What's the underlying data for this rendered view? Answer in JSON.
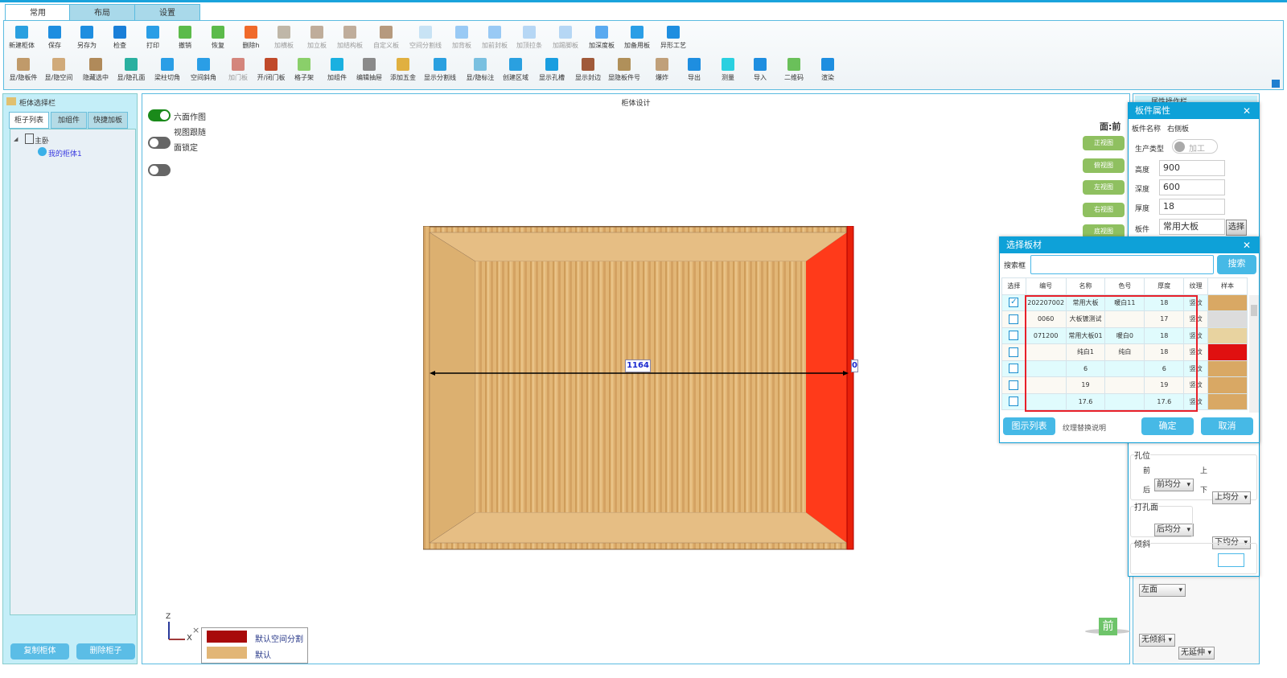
{
  "tabs": [
    "常用",
    "布局",
    "设置"
  ],
  "toolbar_row1": [
    {
      "label": "新建柜体",
      "icon": "new-cabinet-icon",
      "color": "#2aa0e0"
    },
    {
      "label": "保存",
      "icon": "save-icon",
      "color": "#1e8ee0"
    },
    {
      "label": "另存为",
      "icon": "save-as-icon",
      "color": "#1e8ee0"
    },
    {
      "label": "检查",
      "icon": "check-icon",
      "color": "#1a7fd8"
    },
    {
      "label": "打印",
      "icon": "print-icon",
      "color": "#2a9ee6"
    },
    {
      "label": "撤销",
      "icon": "undo-icon",
      "color": "#5cbb4a"
    },
    {
      "label": "恢复",
      "icon": "redo-icon",
      "color": "#5cbb4a"
    },
    {
      "label": "删除h",
      "icon": "delete-icon",
      "color": "#f06a2a"
    },
    {
      "label": "加横板",
      "icon": "horizontal-board-icon",
      "color": "#9a8a70",
      "dim": true
    },
    {
      "label": "加立板",
      "icon": "vertical-board-icon",
      "color": "#9a7a5a",
      "dim": true
    },
    {
      "label": "加结构板",
      "icon": "structure-board-icon",
      "color": "#9a7a5a",
      "dim": true
    },
    {
      "label": "自定义板",
      "icon": "custom-board-icon",
      "color": "#8a5a2a",
      "dim": true
    },
    {
      "label": "空间分割线",
      "icon": "space-divider-icon",
      "color": "#a9d4f0",
      "dim": true
    },
    {
      "label": "加背板",
      "icon": "back-board-icon",
      "color": "#5aaaf0",
      "dim": true
    },
    {
      "label": "加前封板",
      "icon": "front-seal-icon",
      "color": "#5aaaf0",
      "dim": true
    },
    {
      "label": "加顶拉条",
      "icon": "top-strip-icon",
      "color": "#8ac0f0",
      "dim": true
    },
    {
      "label": "加踢脚板",
      "icon": "kickboard-icon",
      "color": "#8ac0f0",
      "dim": true
    },
    {
      "label": "加深度板",
      "icon": "depth-board-icon",
      "color": "#5aaaf0"
    },
    {
      "label": "加备用板",
      "icon": "spare-board-icon",
      "color": "#2a9ee6"
    },
    {
      "label": "异形工艺",
      "icon": "special-shape-icon",
      "color": "#1e8ee0"
    }
  ],
  "toolbar_row2": [
    {
      "label": "显/隐板件",
      "icon": "show-hide-board-icon",
      "color": "#c09a6a"
    },
    {
      "label": "显/隐空间",
      "icon": "show-hide-space-icon",
      "color": "#d0aa7a"
    },
    {
      "label": "隐藏选中",
      "icon": "hide-selected-icon",
      "color": "#b08a5a"
    },
    {
      "label": "显/隐孔面",
      "icon": "show-hide-hole-icon",
      "color": "#2ab0a0"
    },
    {
      "label": "梁柱切角",
      "icon": "beam-cut-icon",
      "color": "#2a9ee6"
    },
    {
      "label": "空间斜角",
      "icon": "space-bevel-icon",
      "color": "#2a9ee6"
    },
    {
      "label": "加门板",
      "icon": "door-icon",
      "color": "#c03a2a",
      "dim": true
    },
    {
      "label": "开/闭门板",
      "icon": "open-close-door-icon",
      "color": "#c04a2a"
    },
    {
      "label": "格子架",
      "icon": "grid-shelf-icon",
      "color": "#8acf6a"
    },
    {
      "label": "加组件",
      "icon": "add-component-icon",
      "color": "#1ab0e0"
    },
    {
      "label": "编辑抽屉",
      "icon": "edit-drawer-icon",
      "color": "#8a8a8a"
    },
    {
      "label": "添加五金",
      "icon": "hardware-icon",
      "color": "#e0b040"
    },
    {
      "label": "显示分割线",
      "icon": "show-divider-icon",
      "color": "#2aa0e0"
    },
    {
      "label": "显/隐标注",
      "icon": "show-hide-dimension-icon",
      "color": "#7ac0e0"
    },
    {
      "label": "创建区域",
      "icon": "create-area-icon",
      "color": "#2aa0e0"
    },
    {
      "label": "显示孔槽",
      "icon": "show-holes-icon",
      "color": "#1a9ee0"
    },
    {
      "label": "显示封边",
      "icon": "show-edge-icon",
      "color": "#a05a3a"
    },
    {
      "label": "显隐板件号",
      "icon": "board-number-icon",
      "color": "#b0905a"
    },
    {
      "label": "爆炸",
      "icon": "explode-icon",
      "color": "#c0a07a"
    },
    {
      "label": "导出",
      "icon": "export-icon",
      "color": "#1e8ee0"
    },
    {
      "label": "测量",
      "icon": "measure-icon",
      "color": "#2ad0e0"
    },
    {
      "label": "导入",
      "icon": "import-icon",
      "color": "#1e8ee0"
    },
    {
      "label": "二维码",
      "icon": "qrcode-icon",
      "color": "#6ac05a"
    },
    {
      "label": "渲染",
      "icon": "render-icon",
      "color": "#1e8ee0"
    }
  ],
  "left_panel": {
    "title": "柜体选择栏",
    "tabs": [
      "柜子列表",
      "加组件",
      "快捷加板"
    ],
    "tree_root": "主卧",
    "tree_child": "我的柜体1",
    "copy_button": "复制柜体",
    "delete_button": "删除柜子"
  },
  "canvas": {
    "title": "柜体设计",
    "toggles": [
      {
        "label": "六面作图",
        "on": true
      },
      {
        "label": "视图跟随",
        "on": false
      },
      {
        "label": "面锁定",
        "on": false
      }
    ],
    "face_label": "面:前",
    "view_buttons": [
      "正视图",
      "俯视图",
      "左视图",
      "右视图",
      "底视图"
    ],
    "dimension_width": "1164",
    "dimension_right": "0",
    "axis_z": "Z",
    "axis_x": "X",
    "legend_close": "×",
    "legend": [
      {
        "label": "默认空间分割",
        "color": "#a80a0a"
      },
      {
        "label": "默认",
        "color": "#e2b676"
      }
    ],
    "front_badge": "前"
  },
  "right_panel": {
    "title": "属性操作栏"
  },
  "board_props": {
    "title": "板件属性",
    "name_label": "板件名称",
    "name_value": "右侧板",
    "prod_type_label": "生产类型",
    "prod_type_value": "加工",
    "height_label": "高度",
    "height": "900",
    "depth_label": "深度",
    "depth": "600",
    "thickness_label": "厚度",
    "thickness": "18",
    "board_label": "板件",
    "board_value": "常用大板",
    "select_button": "选择",
    "holes": {
      "title": "孔位",
      "front_label": "前",
      "front": "前均分",
      "top_label": "上",
      "top": "上均分",
      "back_label": "后",
      "back": "后均分",
      "bottom_label": "下",
      "bottom": "下均分"
    },
    "drill_face": {
      "title": "打孔面",
      "value": "左面"
    },
    "tilt": {
      "title": "倾斜",
      "v1": "无倾斜",
      "v2": "无延伸",
      "v3": ""
    }
  },
  "material_dialog": {
    "title": "选择板材",
    "search_label": "搜索框",
    "search_value": "",
    "search_button": "搜索",
    "columns": [
      "选择",
      "编号",
      "名称",
      "色号",
      "厚度",
      "纹理",
      "样本"
    ],
    "rows": [
      {
        "checked": true,
        "code": "202207002",
        "name": "常用大板",
        "color": "暖白11",
        "thick": "18",
        "grain": "竖纹",
        "sample": "#d9a864"
      },
      {
        "checked": false,
        "code": "0060",
        "name": "大板镀测试",
        "color": "",
        "thick": "17",
        "grain": "竖纹",
        "sample": "#dcdcdc"
      },
      {
        "checked": false,
        "code": "071200",
        "name": "常用大板01",
        "color": "暖白0",
        "thick": "18",
        "grain": "竖纹",
        "sample": "#e8d3a0"
      },
      {
        "checked": false,
        "code": "",
        "name": "纯白1",
        "color": "纯白",
        "thick": "18",
        "grain": "竖纹",
        "sample": "#e01010"
      },
      {
        "checked": false,
        "code": "",
        "name": "6",
        "color": "",
        "thick": "6",
        "grain": "竖纹",
        "sample": "#d9a864"
      },
      {
        "checked": false,
        "code": "",
        "name": "19",
        "color": "",
        "thick": "19",
        "grain": "竖纹",
        "sample": "#d9a864"
      },
      {
        "checked": false,
        "code": "",
        "name": "17.6",
        "color": "",
        "thick": "17.6",
        "grain": "竖纹",
        "sample": "#d9a864"
      }
    ],
    "list_button": "图示列表",
    "texture_note": "纹理替换说明",
    "ok_button": "确定",
    "cancel_button": "取消"
  }
}
